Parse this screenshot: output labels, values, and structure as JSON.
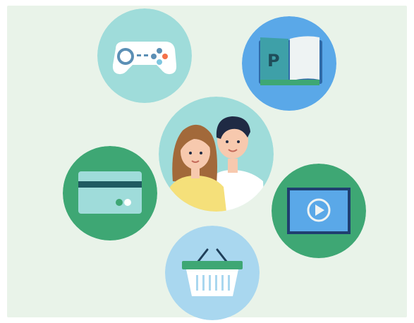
{
  "illustration": {
    "book_cover_letter": "P",
    "colors": {
      "background": "#e9f3e9",
      "light_teal": "#9fdcda",
      "blue": "#5aa8e8",
      "green": "#3ea774",
      "light_blue": "#a9d7ef",
      "orange_accent": "#f4714a"
    },
    "icons": [
      "gamepad-icon",
      "book-icon",
      "couple-avatar",
      "credit-card-icon",
      "video-player-icon",
      "shopping-basket-icon"
    ]
  }
}
